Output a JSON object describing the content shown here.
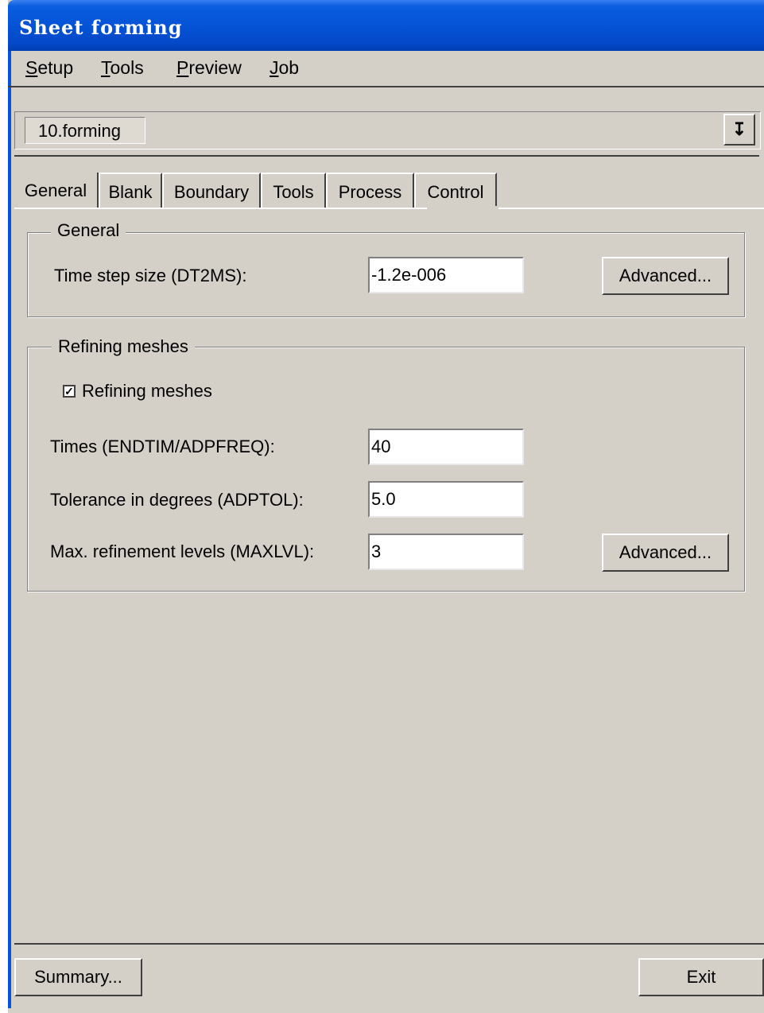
{
  "window": {
    "title": "Sheet forming"
  },
  "menu": [
    {
      "label": "Setup",
      "mnemonic": "S",
      "rest": "etup"
    },
    {
      "label": "Tools",
      "mnemonic": "T",
      "rest": "ools"
    },
    {
      "label": "Preview",
      "mnemonic": "P",
      "rest": "review"
    },
    {
      "label": "Job",
      "mnemonic": "J",
      "rest": "ob"
    }
  ],
  "selector": {
    "value": "10.forming",
    "dropdown_icon": "double-down-arrow"
  },
  "tabs": [
    {
      "label": "General"
    },
    {
      "label": "Blank"
    },
    {
      "label": "Boundary"
    },
    {
      "label": "Tools"
    },
    {
      "label": "Process"
    },
    {
      "label": "Control",
      "active": true
    }
  ],
  "general_group": {
    "legend": "General",
    "time_step_label": "Time step size (DT2MS):",
    "time_step_value": "-1.2e-006",
    "advanced_label": "Advanced..."
  },
  "refining_group": {
    "legend": "Refining meshes",
    "checkbox_label": "Refining meshes",
    "checkbox_checked": true,
    "times_label": "Times (ENDTIM/ADPFREQ):",
    "times_value": "40",
    "tolerance_label": "Tolerance in degrees (ADPTOL):",
    "tolerance_value": "5.0",
    "maxlvl_label": "Max. refinement levels (MAXLVL):",
    "maxlvl_value": "3",
    "advanced_label": "Advanced..."
  },
  "footer": {
    "summary_label": "Summary...",
    "exit_label": "Exit"
  }
}
